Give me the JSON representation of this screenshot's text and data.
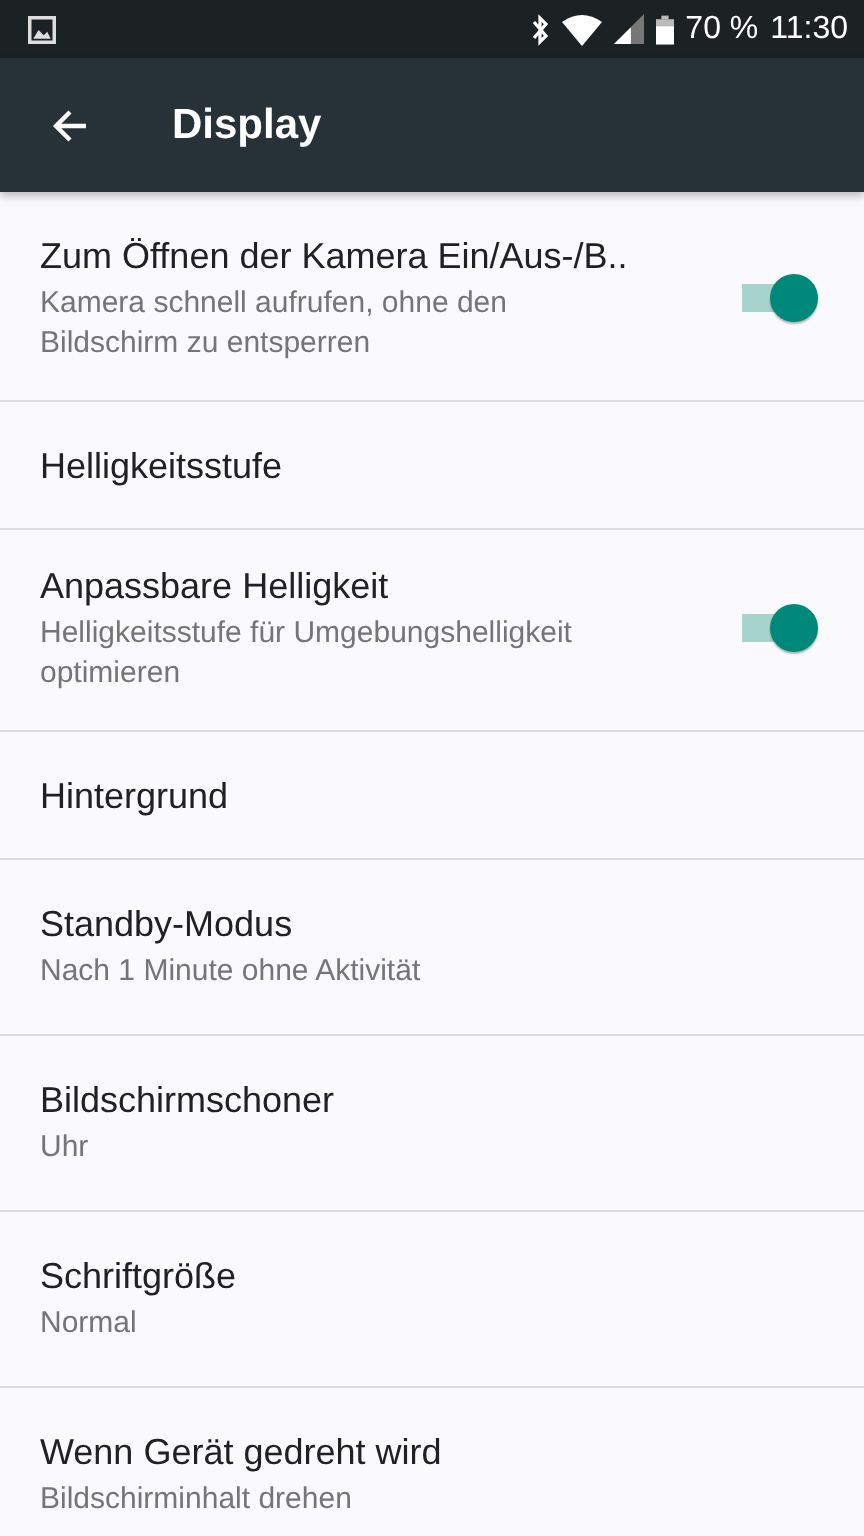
{
  "status_bar": {
    "battery": "70 %",
    "time": "11:30"
  },
  "toolbar": {
    "title": "Display"
  },
  "items": [
    {
      "kind": "switch",
      "title": "Zum Öffnen der Kamera Ein/Aus-/B..",
      "summary": "Kamera schnell aufrufen, ohne den Bildschirm zu entsperren",
      "on": true
    },
    {
      "kind": "plain",
      "title": "Helligkeitsstufe"
    },
    {
      "kind": "switch",
      "title": "Anpassbare Helligkeit",
      "summary": "Helligkeitsstufe für Umgebungshelligkeit optimieren",
      "on": true
    },
    {
      "kind": "plain",
      "title": "Hintergrund"
    },
    {
      "kind": "plain",
      "title": "Standby-Modus",
      "summary": "Nach 1 Minute ohne Aktivität"
    },
    {
      "kind": "plain",
      "title": "Bildschirmschoner",
      "summary": "Uhr"
    },
    {
      "kind": "plain",
      "title": "Schriftgröße",
      "summary": "Normal"
    },
    {
      "kind": "plain",
      "title": "Wenn Gerät gedreht wird",
      "summary": "Bildschirminhalt drehen"
    }
  ]
}
